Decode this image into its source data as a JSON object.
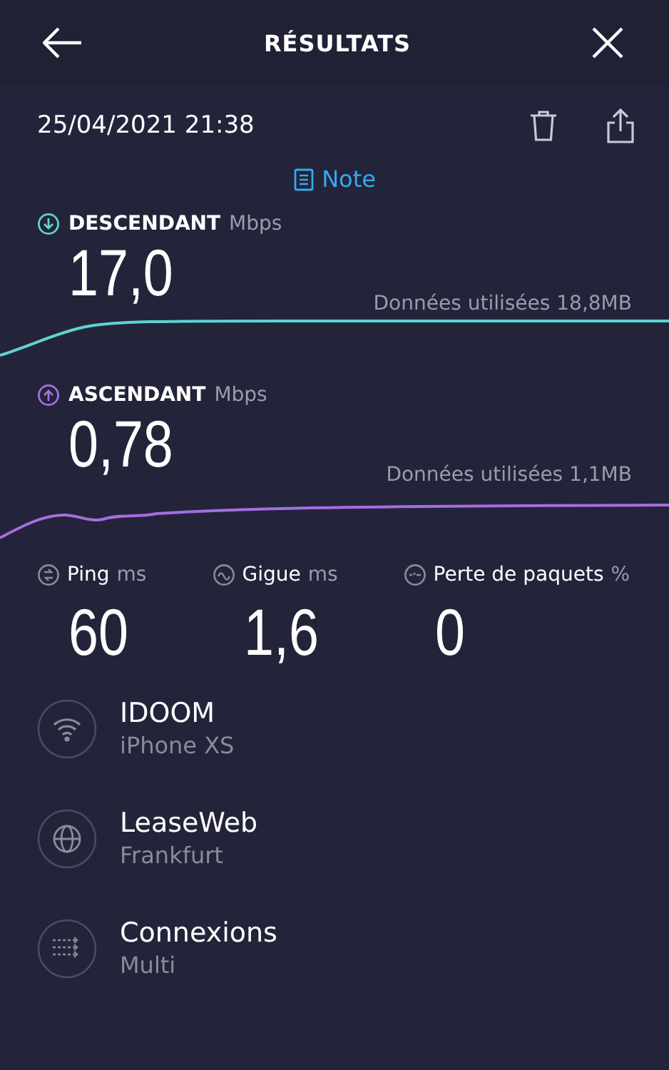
{
  "header": {
    "title": "RÉSULTATS"
  },
  "date": "25/04/2021 21:38",
  "note": {
    "label": "Note"
  },
  "speeds": [
    {
      "kind": "download",
      "label": "DESCENDANT",
      "unit": "Mbps",
      "value": "17,0",
      "data_used": "Données utilisées 18,8MB",
      "color": "#5fd3d3"
    },
    {
      "kind": "upload",
      "label": "ASCENDANT",
      "unit": "Mbps",
      "value": "0,78",
      "data_used": "Données utilisées 1,1MB",
      "color": "#a56ee0"
    }
  ],
  "metrics": [
    {
      "kind": "ping",
      "label": "Ping",
      "unit": "ms",
      "value": "60"
    },
    {
      "kind": "jitter",
      "label": "Gigue",
      "unit": "ms",
      "value": "1,6"
    },
    {
      "kind": "loss",
      "label": "Perte de paquets",
      "unit": "%",
      "value": "0"
    }
  ],
  "info": [
    {
      "kind": "wifi",
      "title": "IDOOM",
      "subtitle": "iPhone XS"
    },
    {
      "kind": "globe",
      "title": "LeaseWeb",
      "subtitle": "Frankfurt"
    },
    {
      "kind": "connections",
      "title": "Connexions",
      "subtitle": "Multi"
    }
  ]
}
